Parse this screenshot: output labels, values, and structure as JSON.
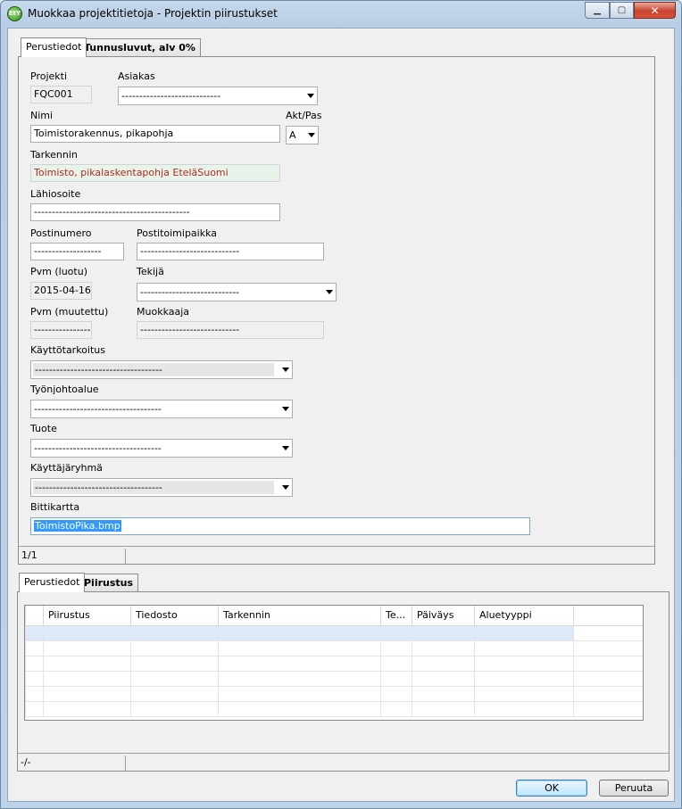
{
  "window": {
    "title": "Muokkaa projektitietoja - Projektin piirustukset",
    "app_icon_text": "EtY"
  },
  "top_tabs": [
    "Perustiedot",
    "Tunnusluvut, alv 0%"
  ],
  "form": {
    "projekti": {
      "label": "Projekti",
      "value": "FQC001"
    },
    "asiakas": {
      "label": "Asiakas",
      "value": "----------------------------"
    },
    "nimi": {
      "label": "Nimi",
      "value": "Toimistorakennus, pikapohja"
    },
    "aktpas": {
      "label": "Akt/Pas",
      "value": "A"
    },
    "tarkennin": {
      "label": "Tarkennin",
      "value": "Toimisto, pikalaskentapohja EteläSuomi"
    },
    "lahiosoite": {
      "label": "Lähiosoite",
      "value": "--------------------------------------------"
    },
    "postinumero": {
      "label": "Postinumero",
      "value": "-------------------"
    },
    "postitoimipaikka": {
      "label": "Postitoimipaikka",
      "value": "----------------------------"
    },
    "pvm_luotu": {
      "label": "Pvm (luotu)",
      "value": "2015-04-16"
    },
    "tekija": {
      "label": "Tekijä",
      "value": "----------------------------"
    },
    "pvm_muutettu": {
      "label": "Pvm (muutettu)",
      "value": "----------------"
    },
    "muokkaaja": {
      "label": "Muokkaaja",
      "value": "----------------------------"
    },
    "kayttotarkoitus": {
      "label": "Käyttötarkoitus",
      "value": "------------------------------------"
    },
    "tyonjohtoalue": {
      "label": "Työnjohtoalue",
      "value": "------------------------------------"
    },
    "tuote": {
      "label": "Tuote",
      "value": "------------------------------------"
    },
    "kayttajaryhma": {
      "label": "Käyttäjäryhmä",
      "value": "------------------------------------"
    },
    "bittikartta": {
      "label": "Bittikartta",
      "value": "ToimistoPika.bmp"
    }
  },
  "status_top": "1/1",
  "bottom_tabs": [
    "Perustiedot",
    "Piirustus"
  ],
  "grid": {
    "columns": [
      "Piirustus",
      "Tiedosto",
      "Tarkennin",
      "Te...",
      "Päiväys",
      "Aluetyyppi",
      ""
    ]
  },
  "status_bottom": "-/-",
  "buttons": {
    "ok": "OK",
    "cancel": "Peruuta"
  }
}
